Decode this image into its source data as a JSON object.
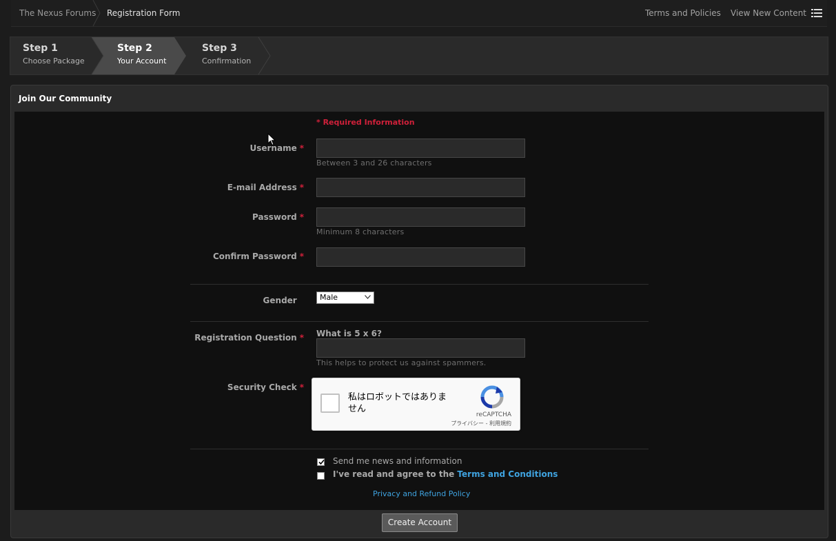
{
  "breadcrumb": {
    "home": "The Nexus Forums",
    "current": "Registration Form"
  },
  "header_links": {
    "terms": "Terms and Policies",
    "new_content": "View New Content"
  },
  "steps": [
    {
      "title": "Step 1",
      "subtitle": "Choose Package"
    },
    {
      "title": "Step 2",
      "subtitle": "Your Account"
    },
    {
      "title": "Step 3",
      "subtitle": "Confirmation"
    }
  ],
  "panel": {
    "title": "Join Our Community"
  },
  "form": {
    "required_info": "* Required Information",
    "required_star": "*",
    "username": {
      "label": "Username",
      "value": "",
      "hint": "Between 3 and 26 characters"
    },
    "email": {
      "label": "E-mail Address",
      "value": ""
    },
    "password": {
      "label": "Password",
      "value": "",
      "hint": "Minimum 8 characters"
    },
    "confirm_password": {
      "label": "Confirm Password",
      "value": ""
    },
    "gender": {
      "label": "Gender",
      "value": "Male"
    },
    "registration_question": {
      "label": "Registration Question",
      "question": "What is 5 x 6?",
      "value": "",
      "hint": "This helps to protect us against spammers."
    },
    "security_check": {
      "label": "Security Check",
      "captcha_text": "私はロボットではありません",
      "captcha_brand": "reCAPTCHA",
      "captcha_links": "プライバシー - 利用規約"
    },
    "news": {
      "label": "Send me news and information",
      "checked": true
    },
    "terms": {
      "prefix": "I've read and agree to the ",
      "link": "Terms and Conditions",
      "checked": false
    },
    "policy_link": "Privacy and Refund Policy",
    "submit": "Create Account"
  },
  "colors": {
    "required": "#d0203a",
    "link": "#3fa3e0",
    "background": "#101010"
  }
}
